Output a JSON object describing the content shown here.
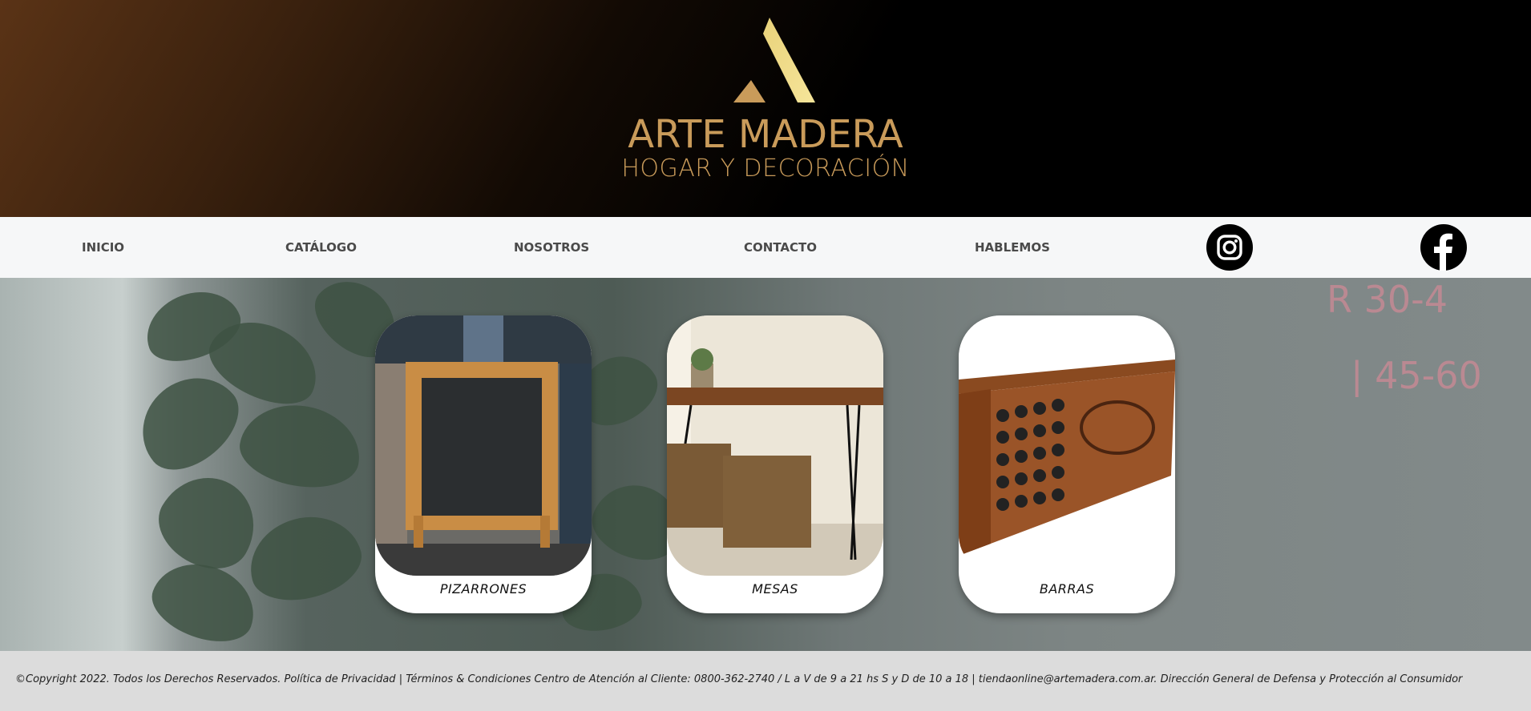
{
  "brand": {
    "name": "ARTE MADERA",
    "tagline": "HOGAR Y DECORACIÓN",
    "accent_color": "#c99b5a"
  },
  "nav": {
    "items": [
      {
        "label": "INICIO"
      },
      {
        "label": "CATÁLOGO"
      },
      {
        "label": "NOSOTROS"
      },
      {
        "label": "CONTACTO"
      },
      {
        "label": "HABLEMOS"
      }
    ],
    "social": [
      {
        "icon": "instagram-icon"
      },
      {
        "icon": "facebook-icon"
      }
    ]
  },
  "categories": [
    {
      "label": "PIZARRONES"
    },
    {
      "label": "MESAS"
    },
    {
      "label": "BARRAS"
    }
  ],
  "background_chalk": {
    "line1": "R 30-4",
    "line2": "| 45-60"
  },
  "footer": {
    "text": "©Copyright 2022. Todos los Derechos Reservados. Política de Privacidad | Términos & Condiciones Centro de Atención al Cliente: 0800-362-2740 / L a V de 9 a 21 hs S y D de 10 a 18 | tiendaonline@artemadera.com.ar. Dirección General de Defensa y Protección al Consumidor"
  }
}
